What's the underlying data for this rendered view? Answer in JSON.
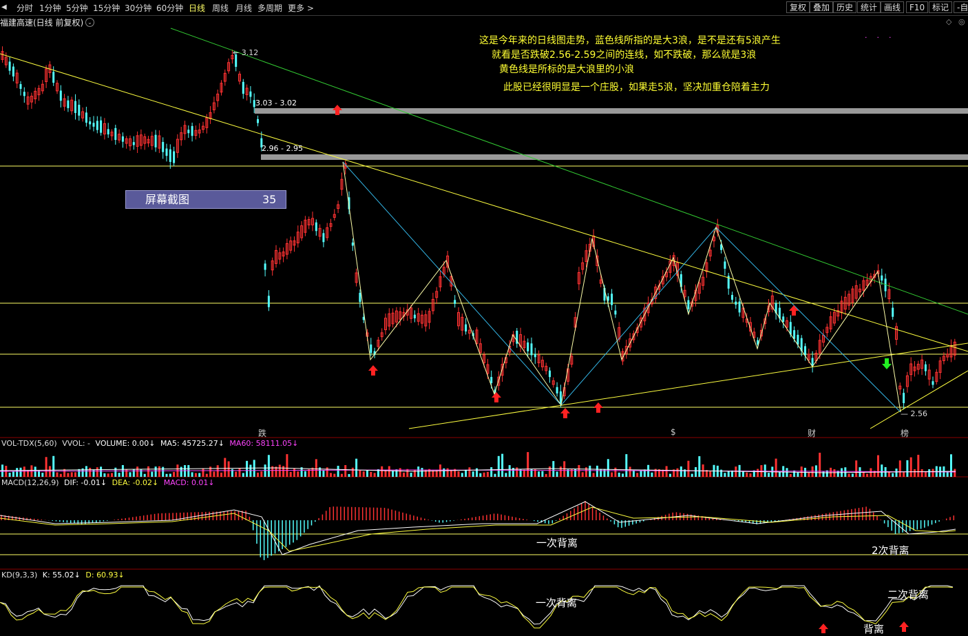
{
  "toolbar": {
    "left": [
      "分时",
      "1分钟",
      "5分钟",
      "15分钟",
      "30分钟",
      "60分钟",
      "日线",
      "周线",
      "月线",
      "多周期",
      "更多 >"
    ],
    "active_index": 6,
    "right": [
      "复权",
      "叠加",
      "历史",
      "统计",
      "画线",
      "F10",
      "标记",
      "-自选"
    ]
  },
  "stock_title": "福建高速(日线 前复权)",
  "annotations": [
    "这是今年来的日线图走势，蓝色线所指的是大3浪，是不是还有5浪产生",
    "就看是否跌破2.56-2.59之间的连线，如不跌破，那么就是3浪",
    "黄色线是所标的是大浪里的小浪",
    "此股已经很明显是一个庄股，如果走5浪，坚决加重仓陪着主力"
  ],
  "screenshot_box": {
    "label": "屏幕截图",
    "number": "35"
  },
  "price_labels": {
    "high": "3.12",
    "zone1": "3.03 - 3.02",
    "zone2": "2.96 - 2.95",
    "low": "2.56"
  },
  "markers": [
    {
      "text": "跌",
      "color": "#33ff33"
    },
    {
      "text": "$",
      "color": "#ff4444"
    },
    {
      "text": "财",
      "color": "#66aaff"
    },
    {
      "text": "榜",
      "color": "#ffaa55"
    }
  ],
  "vol_header": {
    "name": "VOL-TDX(5,60)",
    "vvol": "VVOL: -",
    "volume": "VOLUME: 0.00↓",
    "ma5": "MA5: 45725.27↓",
    "ma60": "MA60: 58111.05↓"
  },
  "macd_header": {
    "name": "MACD(12,26,9)",
    "dif": "DIF: -0.01↓",
    "dea": "DEA: -0.02↓",
    "macd": "MACD: 0.01↓"
  },
  "kd_header": {
    "name": "KD(9,3,3)",
    "k": "K: 55.02↓",
    "d": "D: 60.93↓"
  },
  "macd_annotations": [
    "一次背离",
    "2次背离"
  ],
  "kd_annotations": [
    "一次背离",
    "二次背离",
    "背离"
  ],
  "colors": {
    "up": "#ff3232",
    "down": "#54ffff",
    "yellow": "#ffff40",
    "green_line": "#33cc33",
    "blue_line": "#33b5e5",
    "ma60": "#ff44ff"
  },
  "chart_data": {
    "type": "candlestick",
    "title": "福建高速(日线 前复权)",
    "price_levels": [
      3.12,
      3.03,
      3.02,
      2.96,
      2.95,
      2.56
    ],
    "wave_points": [
      {
        "label": "high",
        "value": 3.12
      },
      {
        "label": "low",
        "value": 2.56
      }
    ],
    "indicators": {
      "VOL-TDX(5,60)": {
        "VOLUME": 0.0,
        "MA5": 45725.27,
        "MA60": 58111.05
      },
      "MACD(12,26,9)": {
        "DIF": -0.01,
        "DEA": -0.02,
        "MACD": 0.01
      },
      "KD(9,3,3)": {
        "K": 55.02,
        "D": 60.93
      }
    }
  }
}
